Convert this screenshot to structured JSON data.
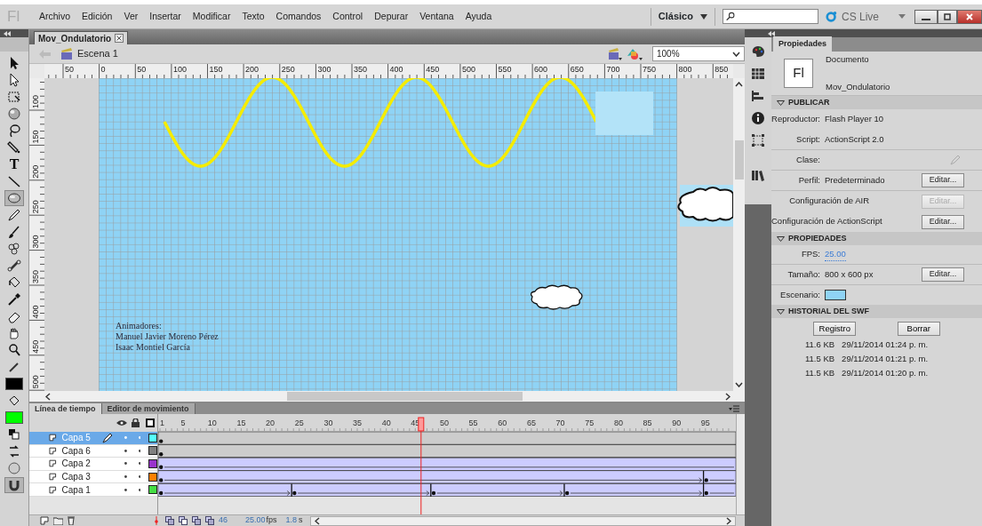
{
  "menubar": {
    "logo": "Fl",
    "menus": [
      "Archivo",
      "Edición",
      "Ver",
      "Insertar",
      "Modificar",
      "Texto",
      "Comandos",
      "Control",
      "Depurar",
      "Ventana",
      "Ayuda"
    ],
    "workspace": "Clásico",
    "cs_live": "CS Live"
  },
  "toolbar": {
    "tools": [
      {
        "kind": "selection",
        "selected": false
      },
      {
        "kind": "subselection",
        "selected": false
      },
      {
        "kind": "transform",
        "selected": false
      },
      {
        "kind": "rotation",
        "selected": false
      },
      {
        "kind": "lasso",
        "selected": false
      },
      {
        "kind": "pen",
        "selected": false
      },
      {
        "kind": "text",
        "label": "T",
        "selected": false
      },
      {
        "kind": "line",
        "selected": false
      },
      {
        "kind": "oval",
        "selected": true
      },
      {
        "kind": "pencil",
        "selected": false
      },
      {
        "kind": "brush",
        "selected": false
      },
      {
        "kind": "deco",
        "selected": false
      },
      {
        "kind": "bone",
        "selected": false
      },
      {
        "kind": "bucket",
        "selected": false
      },
      {
        "kind": "eyedropper",
        "selected": false
      },
      {
        "kind": "eraser",
        "selected": false
      },
      {
        "kind": "hand",
        "selected": false
      },
      {
        "kind": "zoom",
        "selected": false
      },
      {
        "kind": "strokepen",
        "selected": false
      },
      {
        "kind": "swatch",
        "color": "#000000",
        "selected": false
      },
      {
        "kind": "fillbucket",
        "selected": false
      },
      {
        "kind": "swatch",
        "color": "#00ff00",
        "selected": false
      },
      {
        "kind": "defaults",
        "selected": false
      },
      {
        "kind": "swap",
        "selected": false
      },
      {
        "kind": "drawingmode",
        "selected": false
      },
      {
        "kind": "snap",
        "selected": true
      }
    ]
  },
  "document": {
    "tab": "Mov_Ondulatorio",
    "scene": "Escena 1",
    "zoom": "100%",
    "ruler": {
      "h_labels": [
        "50",
        "0",
        "50",
        "100",
        "150",
        "200",
        "250",
        "300",
        "350",
        "400",
        "450",
        "500",
        "550",
        "600",
        "650",
        "700",
        "750",
        "800",
        "850"
      ],
      "v_labels": [
        "100",
        "150",
        "200",
        "250",
        "300",
        "350",
        "400",
        "450",
        "500"
      ]
    },
    "stage": {
      "color": "#8fd3f5",
      "credits": [
        "Animadores:",
        "Manuel Javier Moreno Pérez",
        "Isaac Montiel García"
      ]
    }
  },
  "timeline": {
    "tabs": [
      {
        "label": "Línea de tiempo",
        "selected": true
      },
      {
        "label": "Editor de movimiento",
        "selected": false
      }
    ],
    "frame_labels": [
      "1",
      "5",
      "10",
      "15",
      "20",
      "25",
      "30",
      "35",
      "40",
      "45",
      "50",
      "55",
      "60",
      "65",
      "70",
      "75",
      "80",
      "85",
      "90",
      "95"
    ],
    "playhead": {
      "level": 0.452
    },
    "layers": [
      {
        "name": "Capa 5",
        "selected": true,
        "editing": true,
        "color": "#55ffff",
        "kind": "static",
        "keyframes": [
          {
            "level": 0
          }
        ]
      },
      {
        "name": "Capa 6",
        "selected": false,
        "editing": false,
        "color": "#808080",
        "kind": "static",
        "keyframes": [
          {
            "level": 0
          }
        ]
      },
      {
        "name": "Capa 2",
        "selected": false,
        "editing": false,
        "color": "#9933cc",
        "kind": "tween",
        "keyframes": [
          {
            "level": 0
          }
        ]
      },
      {
        "name": "Capa 3",
        "selected": false,
        "editing": false,
        "color": "#ff8000",
        "kind": "tween",
        "keyframes": [
          {
            "level": 0
          },
          {
            "level": 0.944
          }
        ]
      },
      {
        "name": "Capa 1",
        "selected": false,
        "editing": false,
        "color": "#44dd44",
        "kind": "tween",
        "keyframes": [
          {
            "level": 0
          },
          {
            "level": 0.231
          },
          {
            "level": 0.472
          },
          {
            "level": 0.703
          },
          {
            "level": 0.944
          }
        ]
      }
    ],
    "status": {
      "frame": "46",
      "fps": "25.00",
      "fps_unit": "fps",
      "time": "1.8",
      "time_unit": "s"
    }
  },
  "properties": {
    "tab": "Propiedades",
    "doc_icon": "Fl",
    "doc_type": "Documento",
    "doc_name": "Mov_Ondulatorio",
    "sections": [
      {
        "title": "PUBLICAR",
        "expanded": true,
        "rows": [
          {
            "kind": "text",
            "label": "Reproductor:",
            "value": "Flash Player 10",
            "divider": false
          },
          {
            "kind": "text",
            "label": "Script:",
            "value": "ActionScript 2.0",
            "divider": true
          },
          {
            "kind": "class",
            "label": "Clase:",
            "divider": true
          },
          {
            "kind": "button",
            "label": "Perfil:",
            "value": "Predeterminado",
            "button": "Editar...",
            "disabled": false,
            "divider": true
          },
          {
            "kind": "widebutton",
            "label": "Configuración de AIR",
            "button": "Editar...",
            "disabled": true,
            "divider": false
          },
          {
            "kind": "widebutton",
            "label": "Configuración de ActionScript",
            "button": "Editar...",
            "disabled": false,
            "divider": false
          }
        ]
      },
      {
        "title": "PROPIEDADES",
        "expanded": true,
        "rows": [
          {
            "kind": "link",
            "label": "FPS:",
            "value": "25.00",
            "divider": true
          },
          {
            "kind": "button",
            "label": "Tamaño:",
            "value": "800 x 600 px",
            "button": "Editar...",
            "disabled": false,
            "divider": true
          },
          {
            "kind": "swatch",
            "label": "Escenario:",
            "color": "#8fd3f5",
            "divider": false
          }
        ]
      },
      {
        "title": "HISTORIAL DEL SWF",
        "expanded": true,
        "buttons": [
          "Registro",
          "Borrar"
        ],
        "entries": [
          {
            "size": "11.6 KB",
            "date": "29/11/2014 01:24 p. m."
          },
          {
            "size": "11.5 KB",
            "date": "29/11/2014 01:21 p. m."
          },
          {
            "size": "11.5 KB",
            "date": "29/11/2014 01:20 p. m."
          }
        ]
      }
    ]
  }
}
